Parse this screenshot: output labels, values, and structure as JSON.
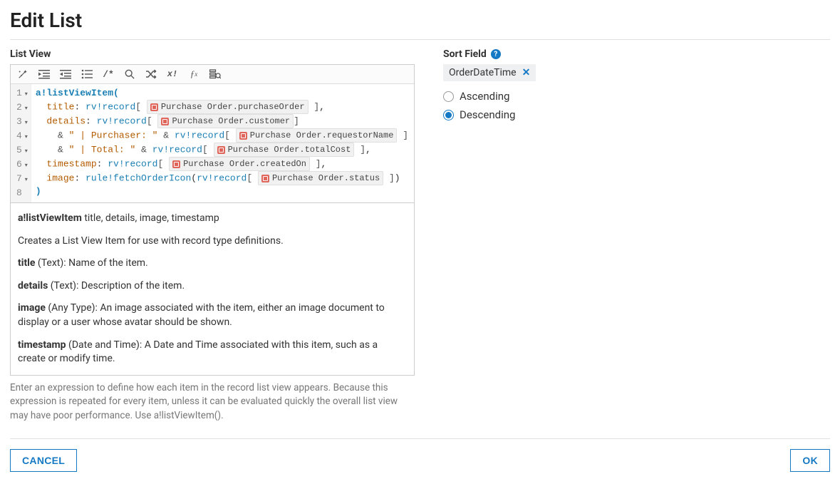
{
  "page": {
    "title": "Edit List"
  },
  "left": {
    "label": "List View",
    "code": {
      "fn": "a!listViewItem",
      "keys": {
        "title": "title",
        "details": "details",
        "timestamp": "timestamp",
        "image": "image"
      },
      "rv": "rv!record",
      "rule": "rule!fetchOrderIcon",
      "chips": {
        "po": "Purchase Order.purchaseOrder",
        "cust": "Purchase Order.customer",
        "req": "Purchase Order.requestorName",
        "total": "Purchase Order.totalCost",
        "created": "Purchase Order.createdOn",
        "status": "Purchase Order.status"
      },
      "str": {
        "purchaser": "\" | Purchaser: \"",
        "total": "\" | Total: \""
      },
      "amp": "&"
    },
    "doc": {
      "sig_fn": "a!listViewItem",
      "sig_args": " title, details, image, timestamp",
      "desc": "Creates a List View Item for use with record type definitions.",
      "title_k": "title",
      "title_d": " (Text): Name of the item.",
      "details_k": "details",
      "details_d": " (Text): Description of the item.",
      "image_k": "image",
      "image_d": " (Any Type): An image associated with the item, either an image document to display or a user whose avatar should be shown.",
      "ts_k": "timestamp",
      "ts_d": " (Date and Time): A Date and Time associated with this item, such as a create or modify time."
    },
    "hint": "Enter an expression to define how each item in the record list view appears. Because this expression is repeated for every item, unless it can be evaluated quickly the overall list view may have poor performance. Use a!listViewItem()."
  },
  "right": {
    "label": "Sort Field",
    "value": "OrderDateTime",
    "remove_glyph": "✕",
    "options": {
      "asc": "Ascending",
      "desc": "Descending"
    },
    "selected": "desc"
  },
  "footer": {
    "cancel": "CANCEL",
    "ok": "OK"
  },
  "glyph": {
    "help": "?"
  }
}
